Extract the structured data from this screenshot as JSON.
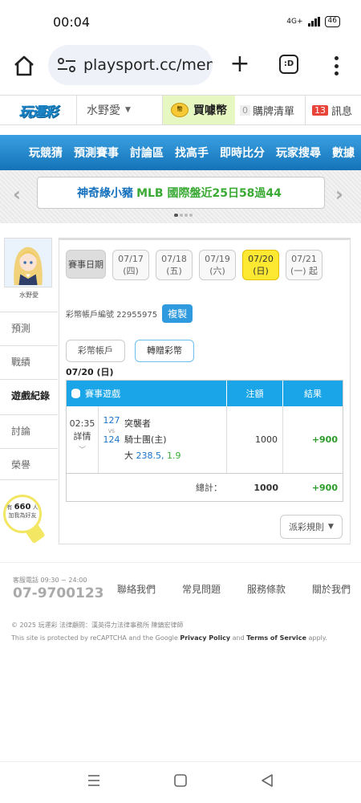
{
  "status_bar": {
    "time": "00:04",
    "network": "4G+",
    "battery": "46"
  },
  "browser": {
    "url": "playsport.cc/men"
  },
  "header": {
    "logo": "玩運彩",
    "user": "水野愛",
    "buy_coin": "買噱幣",
    "cart_count": "0",
    "cart_label": "購牌清單",
    "msg_count": "13",
    "msg_label": "訊息"
  },
  "nav": {
    "items": [
      "玩競猜",
      "預測賽事",
      "討論區",
      "找高手",
      "即時比分",
      "玩家搜尋",
      "數據"
    ]
  },
  "marquee": {
    "p1": "神奇綠小豬",
    "p2": "MLB 國際盤近25日58過44"
  },
  "sidebar": {
    "username": "水野愛",
    "items": [
      "預測",
      "戰績",
      "遊戲紀錄",
      "討論",
      "榮譽"
    ],
    "bulb_prefix": "有",
    "bulb_count": "660",
    "bulb_suffix": "人",
    "bulb_text": "加我為好友"
  },
  "main": {
    "date_label": "賽事日期",
    "dates": [
      {
        "d": "07/17",
        "w": "(四)"
      },
      {
        "d": "07/18",
        "w": "(五)"
      },
      {
        "d": "07/19",
        "w": "(六)"
      },
      {
        "d": "07/20",
        "w": "(日)"
      },
      {
        "d": "07/21",
        "w": "(一) 起"
      }
    ],
    "account_label": "彩幣帳戶編號 22955975",
    "copy_label": "複製",
    "tab1": "彩幣帳戶",
    "tab2": "轉贈彩幣",
    "date_heading": "07/20 (日)",
    "table": {
      "h_game": "賽事遊戲",
      "h_bet": "注額",
      "h_result": "結果",
      "row": {
        "time": "02:35",
        "detail": "詳情",
        "id1": "127",
        "vs": "VS",
        "id2": "124",
        "team1": "突襲者",
        "team2": "騎士團(主)",
        "pick_label": "大",
        "pick_line": "238.5",
        "pick_odds": "1.9",
        "bet": "1000",
        "result": "+900"
      },
      "total_label": "總計：",
      "total_bet": "1000",
      "total_result": "+900"
    },
    "rules_label": "派彩規則"
  },
  "footer": {
    "hotline_label": "客服電話 09:30 ~ 24:00",
    "hotline": "07-9700123",
    "links": [
      "聯絡我們",
      "常見問題",
      "服務條款",
      "關於我們"
    ],
    "copyright": "© 2025 玩運彩 法律顧問：漢英得力法律事務所 陳鎮宏律師",
    "recaptcha_pre": "This site is protected by reCAPTCHA and the Google",
    "privacy": "Privacy Policy",
    "and": "and",
    "terms": "Terms of Service",
    "apply": "apply."
  }
}
